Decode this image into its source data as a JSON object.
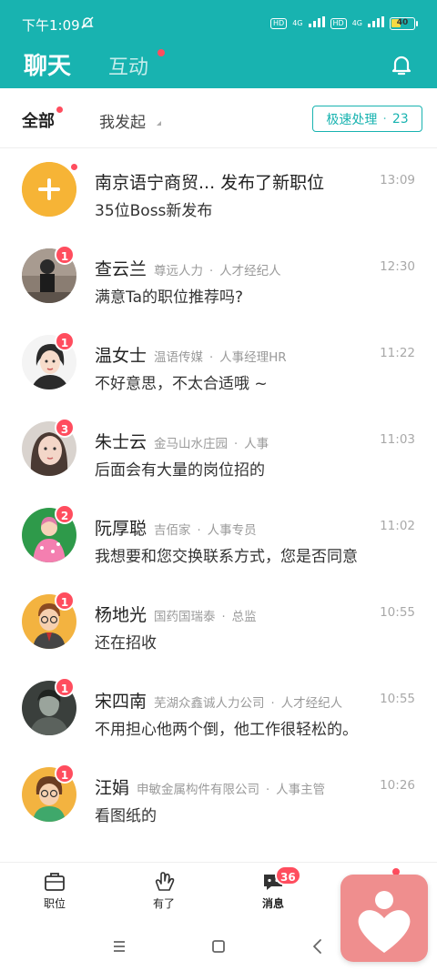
{
  "status_bar": {
    "time": "下午1:09",
    "hd1": "HD",
    "net1": "4G",
    "hd2": "HD",
    "net2": "4G",
    "battery": "40"
  },
  "header": {
    "tab_chat": "聊天",
    "tab_interact": "互动"
  },
  "filters": {
    "all": "全部",
    "mine": "我发起",
    "fast": {
      "label": "极速处理",
      "sep": "·",
      "count": "23"
    }
  },
  "conversations": [
    {
      "name": "南京语宁商贸... 发布了新职位",
      "company": "",
      "role": "",
      "time": "13:09",
      "message": "35位Boss新发布",
      "badge": ""
    },
    {
      "name": "查云兰",
      "company": "尊远人力",
      "role": "人才经纪人",
      "time": "12:30",
      "message": "满意Ta的职位推荐吗?",
      "badge": "1"
    },
    {
      "name": "温女士",
      "company": "温语传媒",
      "role": "人事经理HR",
      "time": "11:22",
      "message": "不好意思，不太合适哦 ~",
      "badge": "1"
    },
    {
      "name": "朱士云",
      "company": "金马山水庄园",
      "role": "人事",
      "time": "11:03",
      "message": "后面会有大量的岗位招的",
      "badge": "3"
    },
    {
      "name": "阮厚聪",
      "company": "吉佰家",
      "role": "人事专员",
      "time": "11:02",
      "message": "我想要和您交换联系方式，您是否同意",
      "badge": "2"
    },
    {
      "name": "杨地光",
      "company": "国药国瑞泰",
      "role": "总监",
      "time": "10:55",
      "message": "还在招收",
      "badge": "1"
    },
    {
      "name": "宋四南",
      "company": "芜湖众鑫诚人力公司",
      "role": "人才经纪人",
      "time": "10:55",
      "message": "不用担心他两个倒，他工作很轻松的。",
      "badge": "1"
    },
    {
      "name": "汪娟",
      "company": "申敏金属构件有限公司",
      "role": "人事主管",
      "time": "10:26",
      "message": "看图纸的",
      "badge": "1"
    }
  ],
  "dot_sep": "·",
  "bottom_nav": {
    "jobs": "职位",
    "youle": "有了",
    "messages": "消息",
    "messages_badge": "36"
  },
  "colors": {
    "accent": "#18b3b0",
    "badge": "#ff4d5e"
  }
}
